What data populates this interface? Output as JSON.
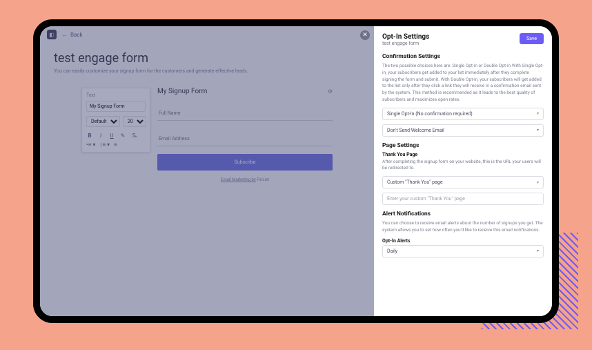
{
  "topbar": {
    "back_label": "Back"
  },
  "page": {
    "title": "test engage form",
    "subtitle": "You can easily customize your signup form for the customers and generate effective leads."
  },
  "toolbox": {
    "label": "Text",
    "text_value": "My Signup Form",
    "font_family": "Default",
    "font_size": "20"
  },
  "preview": {
    "title": "My Signup Form",
    "input1_placeholder": "Full Name",
    "input2_placeholder": "Email Address",
    "button_label": "Subscribe",
    "credit_prefix": "Email Marketing by",
    "credit_brand": "FinList"
  },
  "panel": {
    "title": "Opt-In Settings",
    "subtitle": "test engage form",
    "save_label": "Save",
    "confirmation": {
      "title": "Confirmation Settings",
      "help": "The two possible choices here are: Single Opt-in or Double Opt-in With Single Opt-in, your subscribers get added to your list immediately after they complete signing the form and submit. With Double Opt-in, your subscribers will get added to the list only after they click a link they will receive in a confirmation email sent by the system. This method is recommended as it leads to the best quality of subscribers and maximizes open rates.",
      "select1": "Single Opt-In (No confirmation required)",
      "select2": "Don't Send Welcome Email"
    },
    "page_settings": {
      "title": "Page Settings",
      "sub": "Thank You Page",
      "help": "After completing the signup form on your website, this is the URL your users will be redirected to.",
      "select": "Custom \"Thank You\" page",
      "input_placeholder": "Enter your custom \"Thank You\" page"
    },
    "alerts": {
      "title": "Alert Notifications",
      "help": "You can choose to receive email alerts about the number of signups you get. The system allows you to set how often you'd like to receive this email notifications.",
      "sub": "Opt-In Alerts",
      "select": "Daily"
    }
  }
}
